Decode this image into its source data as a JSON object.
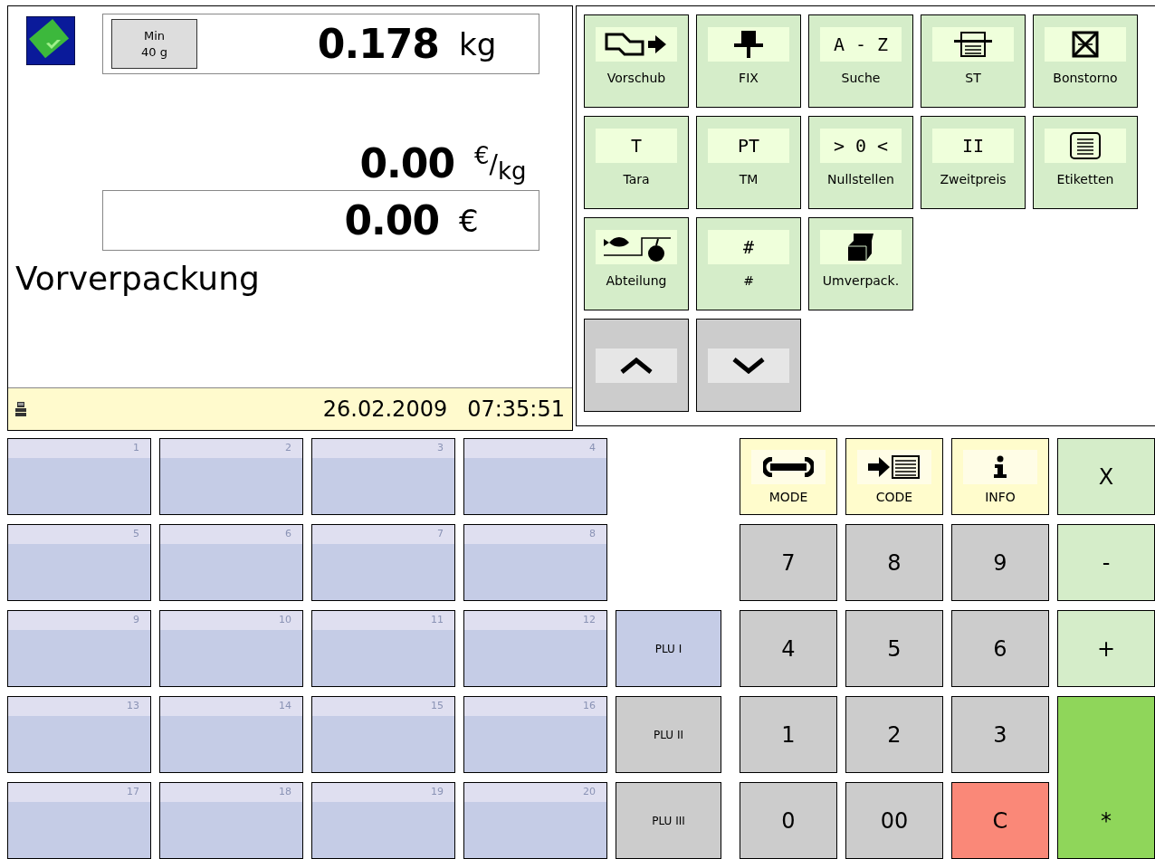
{
  "scale": {
    "min_weight": {
      "label": "Min",
      "value": "40 g"
    },
    "weight": {
      "value": "0.178",
      "unit": "kg"
    },
    "unit_price": {
      "value": "0.00",
      "unit": "$^{€}$/$_{kg}$"
    },
    "total": {
      "value": "0.00",
      "unit": "€"
    },
    "mode_text": "Vorverpackung",
    "status_bar": {
      "date": "26.02.2009",
      "time": "07:35:51"
    }
  },
  "function_keys": [
    {
      "kind": "icon",
      "label": "Vorschub"
    },
    {
      "kind": "icon",
      "label": "FIX"
    },
    {
      "kind": "symbol",
      "symbol": "A - Z",
      "label": "Suche"
    },
    {
      "kind": "icon",
      "label": "ST"
    },
    {
      "kind": "icon",
      "label": "Bonstorno"
    },
    {
      "kind": "symbol",
      "symbol": "T",
      "label": "Tara"
    },
    {
      "kind": "symbol",
      "symbol": "PT",
      "label": "TM"
    },
    {
      "kind": "symbol",
      "symbol": "> 0 <",
      "label": "Nullstellen"
    },
    {
      "kind": "symbol",
      "symbol": "II",
      "label": "Zweitpreis"
    },
    {
      "kind": "icon",
      "label": "Etiketten"
    },
    {
      "kind": "icon",
      "label": "Abteilung"
    },
    {
      "kind": "symbol",
      "symbol": "#",
      "label": "#"
    },
    {
      "kind": "icon",
      "label": "Umverpack."
    }
  ],
  "plu_keys": [
    {
      "number": "1"
    },
    {
      "number": "2"
    },
    {
      "number": "3"
    },
    {
      "number": "4"
    },
    {
      "number": "5"
    },
    {
      "number": "6"
    },
    {
      "number": "7"
    },
    {
      "number": "8"
    },
    {
      "number": "9"
    },
    {
      "number": "10"
    },
    {
      "number": "11"
    },
    {
      "number": "12"
    },
    {
      "number": "13"
    },
    {
      "number": "14"
    },
    {
      "number": "15"
    },
    {
      "number": "16"
    },
    {
      "number": "17"
    },
    {
      "number": "18"
    },
    {
      "number": "19"
    },
    {
      "number": "20"
    }
  ],
  "plu_levels": [
    {
      "label": "PLU I",
      "selected": true
    },
    {
      "label": "PLU II",
      "selected": false
    },
    {
      "label": "PLU III",
      "selected": false
    }
  ],
  "keypad": [
    {
      "kind": "function",
      "label": "MODE"
    },
    {
      "kind": "function",
      "label": "CODE"
    },
    {
      "kind": "function",
      "label": "INFO"
    },
    {
      "kind": "operator",
      "label": "X"
    },
    {
      "kind": "digit",
      "label": "7"
    },
    {
      "kind": "digit",
      "label": "8"
    },
    {
      "kind": "digit",
      "label": "9"
    },
    {
      "kind": "operator",
      "label": "-"
    },
    {
      "kind": "digit",
      "label": "4"
    },
    {
      "kind": "digit",
      "label": "5"
    },
    {
      "kind": "digit",
      "label": "6"
    },
    {
      "kind": "operator",
      "label": "+"
    },
    {
      "kind": "digit",
      "label": "1"
    },
    {
      "kind": "digit",
      "label": "2"
    },
    {
      "kind": "digit",
      "label": "3"
    },
    {
      "kind": "digit",
      "label": "0"
    },
    {
      "kind": "digit",
      "label": "00"
    },
    {
      "kind": "clear",
      "label": "C"
    },
    {
      "kind": "enter",
      "label": "*"
    }
  ]
}
